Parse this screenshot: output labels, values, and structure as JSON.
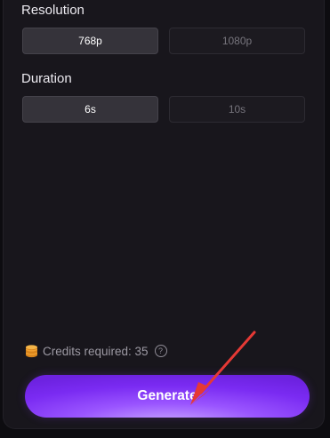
{
  "resolution": {
    "label": "Resolution",
    "options": [
      {
        "label": "768p",
        "selected": true
      },
      {
        "label": "1080p",
        "selected": false
      }
    ]
  },
  "duration": {
    "label": "Duration",
    "options": [
      {
        "label": "6s",
        "selected": true
      },
      {
        "label": "10s",
        "selected": false
      }
    ]
  },
  "credits": {
    "text": "Credits required: 35",
    "help_glyph": "?",
    "icon": "coin-stack-icon"
  },
  "generate_label": "Generate",
  "colors": {
    "accent": "#7a2bf2",
    "annotation_arrow": "#e53935",
    "coin": "#f0a030"
  }
}
